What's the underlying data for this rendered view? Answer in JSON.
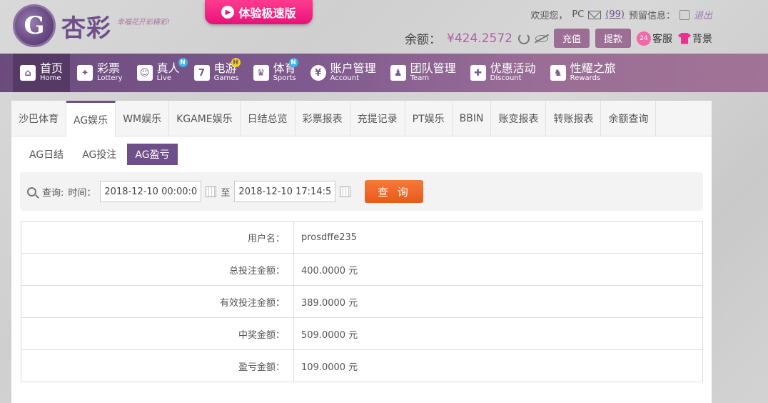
{
  "header": {
    "logo_mark": "G",
    "logo_name": "杏彩",
    "slogan": "幸福花开彩精彩!",
    "promo": "体验极速版",
    "welcome": "欢迎您，",
    "username_short": "PC",
    "message_count": "(99)",
    "notice_label": "预留信息：",
    "logout": "退出",
    "balance_label": "余额：",
    "balance_value": "¥424.2572",
    "deposit": "充值",
    "withdraw": "提款",
    "service_badge": "24",
    "service": "客服",
    "skin": "背景"
  },
  "nav": [
    {
      "zh": "首页",
      "en": "Home",
      "icon": "⌂",
      "active": true
    },
    {
      "zh": "彩票",
      "en": "Lottery",
      "icon": "✦"
    },
    {
      "zh": "真人",
      "en": "Live",
      "icon": "☺",
      "badge": "N"
    },
    {
      "zh": "电游",
      "en": "Games",
      "icon": "7",
      "badge": "H"
    },
    {
      "zh": "体育",
      "en": "Sports",
      "icon": "♛",
      "badge": "N"
    },
    {
      "zh": "账户管理",
      "en": "Account",
      "icon": "¥"
    },
    {
      "zh": "团队管理",
      "en": "Team",
      "icon": "♟"
    },
    {
      "zh": "优惠活动",
      "en": "Discount",
      "icon": "✚"
    },
    {
      "zh": "性耀之旅",
      "en": "Rewards",
      "icon": "♞"
    }
  ],
  "tabs": [
    "沙巴体育",
    "AG娱乐",
    "WM娱乐",
    "KGAME娱乐",
    "日结总览",
    "彩票报表",
    "充提记录",
    "PT娱乐",
    "BBIN",
    "账变报表",
    "转账报表",
    "余额查询"
  ],
  "active_tab": 1,
  "subtabs": [
    "AG日结",
    "AG投注",
    "AG盈亏"
  ],
  "active_subtab": 2,
  "query": {
    "label": "查询:",
    "time_label": "时间：",
    "start": "2018-12-10 00:00:00",
    "to": "至",
    "end": "2018-12-10 17:14:55",
    "button": "查 询"
  },
  "results": [
    {
      "label": "用户名：",
      "value": "prosdffe235"
    },
    {
      "label": "总投注金额：",
      "value": "400.0000 元"
    },
    {
      "label": "有效投注金额：",
      "value": "389.0000 元"
    },
    {
      "label": "中奖金额：",
      "value": "509.0000 元"
    },
    {
      "label": "盈亏金额：",
      "value": "109.0000 元"
    }
  ],
  "colors": {
    "brand": "#6e4f8a",
    "accent": "#b05fa3",
    "search_button": "#e85a1c"
  }
}
